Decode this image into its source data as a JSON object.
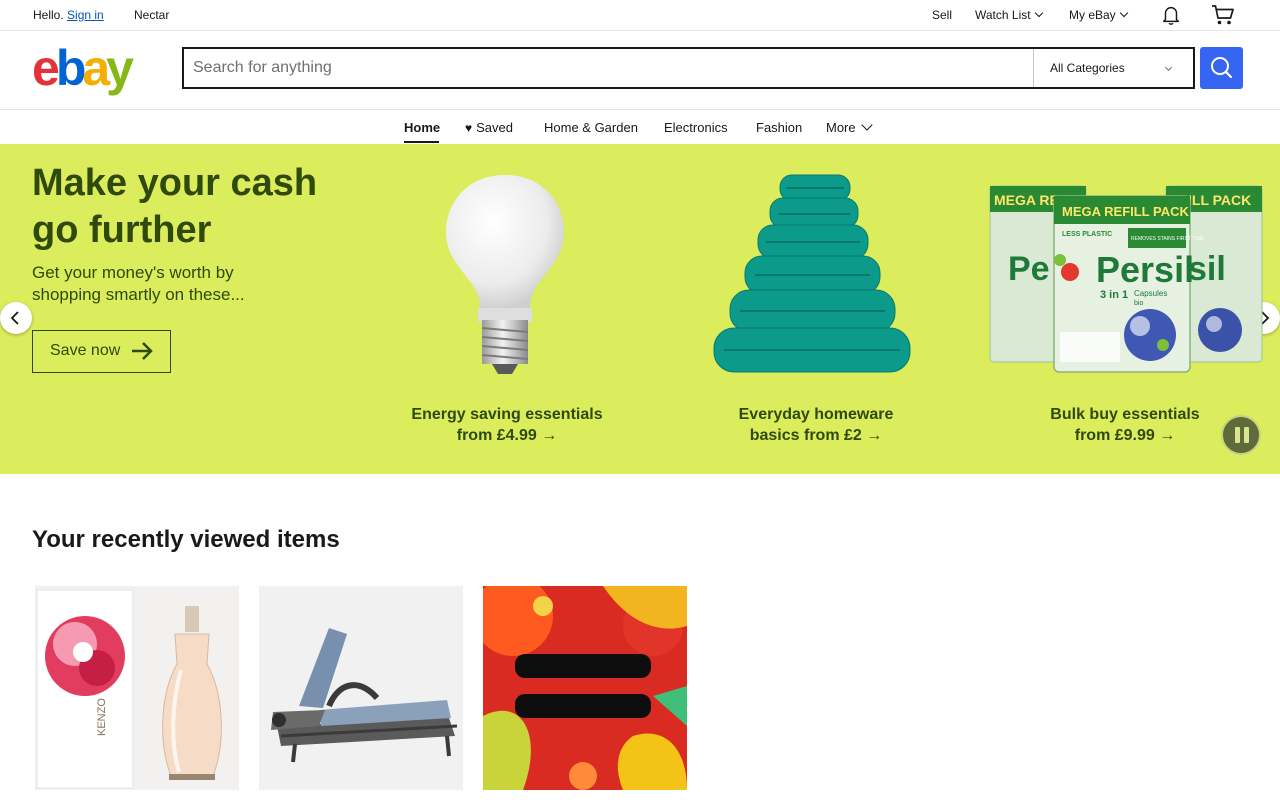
{
  "topbar": {
    "hello": "Hello.",
    "sign_in": "Sign in",
    "nectar": "Nectar",
    "sell": "Sell",
    "watch_list": "Watch List",
    "my_ebay": "My eBay"
  },
  "logo": {
    "e": "e",
    "b": "b",
    "a": "a",
    "y": "y"
  },
  "search": {
    "placeholder": "Search for anything",
    "category": "All Categories"
  },
  "nav": {
    "home": "Home",
    "saved": "Saved",
    "home_garden": "Home & Garden",
    "electronics": "Electronics",
    "fashion": "Fashion",
    "more": "More"
  },
  "hero": {
    "title": "Make your cash go further",
    "subtitle": "Get your money's worth by shopping smartly on these...",
    "cta": "Save now",
    "tiles": [
      {
        "caption_line1": "Energy saving essentials",
        "caption_line2": "from £4.99",
        "icon": "light-bulb"
      },
      {
        "caption_line1": "Everyday homeware",
        "caption_line2": "basics from £2",
        "icon": "towel-stack"
      },
      {
        "caption_line1": "Bulk buy essentials",
        "caption_line2": "from £9.99",
        "icon": "detergent-packs"
      }
    ],
    "packs": {
      "header": "MEGA REFILL PACK",
      "header_partial_left": "MEGA RE",
      "header_partial_right": "ILL PACK",
      "sub": "LESS PLASTIC",
      "brand": "Persil",
      "brand_partial_left": "Pe",
      "brand_partial_right": "sil",
      "format": "3 in 1",
      "caps": "Capsules",
      "bio": "bio",
      "badge": "REMOVES STAINS FIRST TIME"
    },
    "background": "#dbec5c",
    "text_color": "#2f4a0c"
  },
  "recently_viewed": {
    "title": "Your recently viewed items",
    "items": [
      {
        "image": "perfume-bottle",
        "box_text": "KENZO"
      },
      {
        "image": "sun-lounger"
      },
      {
        "image": "album-cover-equals"
      }
    ]
  },
  "colors": {
    "accent": "#3665f3",
    "link": "#0654ba",
    "logo_e": "#e53238",
    "logo_b": "#0064d2",
    "logo_a": "#f5af02",
    "logo_y": "#86b817"
  }
}
